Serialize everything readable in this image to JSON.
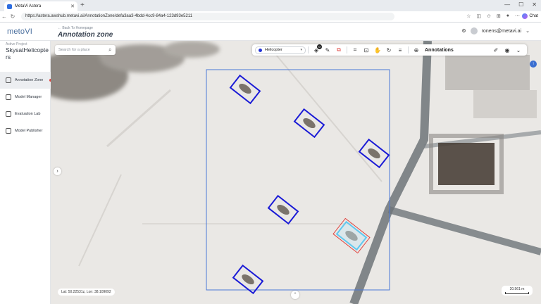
{
  "browser": {
    "tab_title": "MetaVi Astera",
    "url": "https://astera.awshub.metavi.ai/AnnotationZone/defa3aa3-4bdd-4cc9-84a4-123d93e5211",
    "chat_label": "Chat"
  },
  "header": {
    "logo": "metoVI",
    "back_link": "← Back To Homepage",
    "title": "Annotation zone",
    "user": "ronens@metavi.ai"
  },
  "sidebar": {
    "project_label": "Active Project",
    "project_name": "SkysatHelicopters",
    "items": [
      {
        "label": "Annotation Zone"
      },
      {
        "label": "Model Manager"
      },
      {
        "label": "Evaluation Lab"
      },
      {
        "label": "Model Publisher"
      }
    ]
  },
  "map": {
    "search_placeholder": "Search for a place",
    "coords": "Lat: 50.22531z, Lon: 38.109092",
    "scale": "20.561 m"
  },
  "toolbar": {
    "class_name": "Helicopter",
    "class_color": "#2233d6",
    "badge": "0",
    "title": "Annotations"
  },
  "colors": {
    "bbox": "#1a1ad6",
    "selected_bbox": "#5fc8f0",
    "selected_outline": "#e0433f",
    "aoi": "#4a78d8"
  }
}
